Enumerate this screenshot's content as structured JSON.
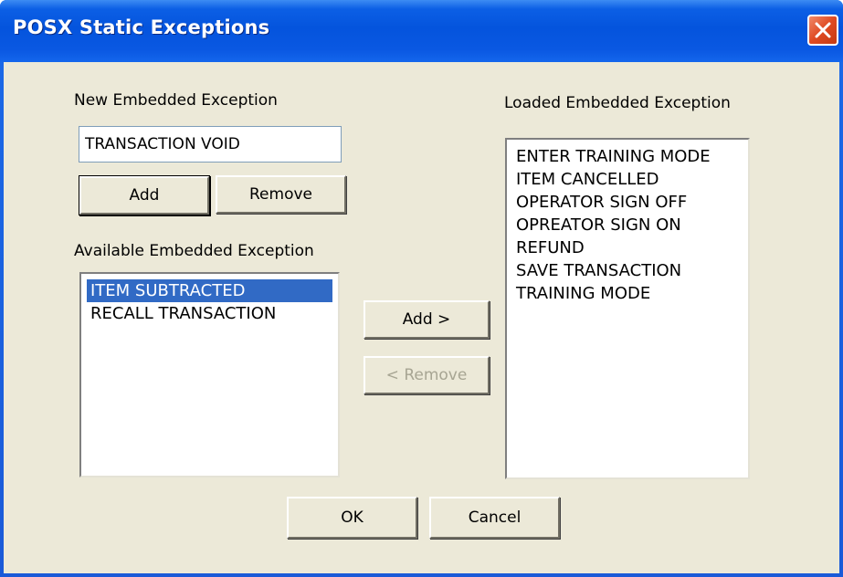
{
  "window": {
    "title": "POSX Static Exceptions"
  },
  "new_exception": {
    "label": "New Embedded Exception",
    "value": "TRANSACTION VOID",
    "add_label": "Add",
    "remove_label": "Remove"
  },
  "available": {
    "label": "Available Embedded Exception",
    "items": [
      "ITEM SUBTRACTED",
      "RECALL TRANSACTION"
    ],
    "selected": "ITEM SUBTRACTED"
  },
  "loaded": {
    "label": "Loaded Embedded Exception",
    "items": [
      "ENTER TRAINING MODE",
      "ITEM CANCELLED",
      "OPERATOR SIGN OFF",
      "OPREATOR SIGN ON",
      "REFUND",
      "SAVE TRANSACTION",
      "TRAINING MODE"
    ]
  },
  "transfer": {
    "add_label": "Add >",
    "remove_label": "< Remove"
  },
  "footer": {
    "ok_label": "OK",
    "cancel_label": "Cancel"
  },
  "colors": {
    "titlebar": "#0454dd",
    "selection": "#316ac5",
    "face": "#ece9d8",
    "close": "#df4a22"
  },
  "icons": {
    "close": "close-icon"
  }
}
